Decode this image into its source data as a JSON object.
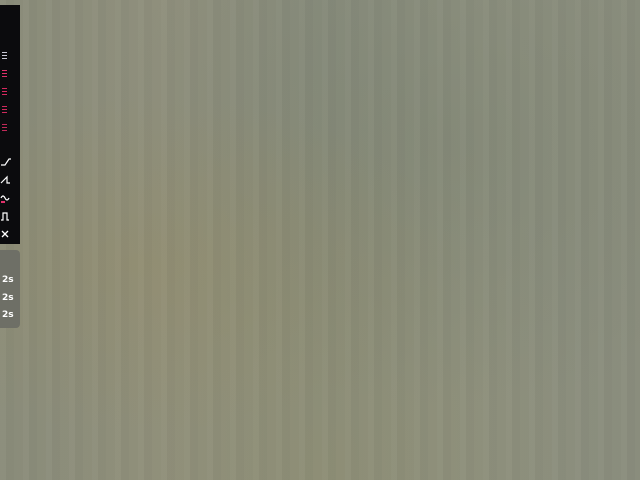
{
  "toolbar": {
    "items": [
      {
        "icon": "list-icon",
        "color": "#c8c8d4"
      },
      {
        "icon": "list-icon",
        "color": "#e0306a"
      },
      {
        "icon": "list-icon",
        "color": "#d8285e"
      },
      {
        "icon": "list-icon",
        "color": "#d02a5c"
      },
      {
        "icon": "list-icon",
        "color": "#c02a58"
      },
      {
        "icon": "ramp-up-wave-icon",
        "color": "#ffffff"
      },
      {
        "icon": "sawtooth-wave-icon",
        "color": "#ffffff"
      },
      {
        "icon": "sine-wave-icon",
        "color": "#ffffff",
        "marker": "#e0306a"
      },
      {
        "icon": "square-wave-icon",
        "color": "#ffffff"
      },
      {
        "icon": "close-icon",
        "color": "#ffffff"
      }
    ]
  },
  "timer_panel": {
    "options": [
      "2s",
      "2s",
      "2s"
    ]
  }
}
